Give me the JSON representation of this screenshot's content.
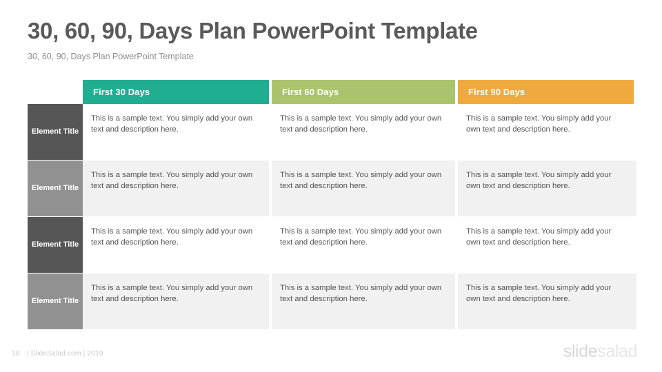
{
  "header": {
    "title": "30, 60, 90, Days Plan PowerPoint Template",
    "subtitle": "30, 60, 90, Days Plan PowerPoint Template"
  },
  "table": {
    "column_headers": [
      {
        "label": "First 30 Days",
        "color": "#20ae91"
      },
      {
        "label": "First 60 Days",
        "color": "#a9c46c"
      },
      {
        "label": "First 90 Days",
        "color": "#f0a93f"
      }
    ],
    "row_title_colors": {
      "dark": "#565656",
      "light": "#919191"
    },
    "row_shade_color": "#f1f1f1",
    "rows": [
      {
        "title": "Element Title",
        "cells": [
          "This is a sample text. You simply add your own text and description here.",
          "This is a sample text. You simply add your own text and description here.",
          "This is a sample text. You simply add your own text and description here."
        ]
      },
      {
        "title": "Element Title",
        "cells": [
          "This is a sample text. You simply add your own text and description here.",
          "This is a sample text. You simply add your own text and description here.",
          "This is a sample text. You simply add your own text and description here."
        ]
      },
      {
        "title": "Element Title",
        "cells": [
          "This is a sample text. You simply add your own text and description here.",
          "This is a sample text. You simply add your own text and description here.",
          "This is a sample text. You simply add your own text and description here."
        ]
      },
      {
        "title": "Element Title",
        "cells": [
          "This is a sample text. You simply add your own text and description here.",
          "This is a sample text. You simply add your own text and description here.",
          "This is a sample text. You simply add your own text and description here."
        ]
      }
    ]
  },
  "footer": {
    "page_number": "18",
    "credit": "| SlideSalad.com | 2019",
    "logo_first": "slide",
    "logo_second": "salad"
  }
}
